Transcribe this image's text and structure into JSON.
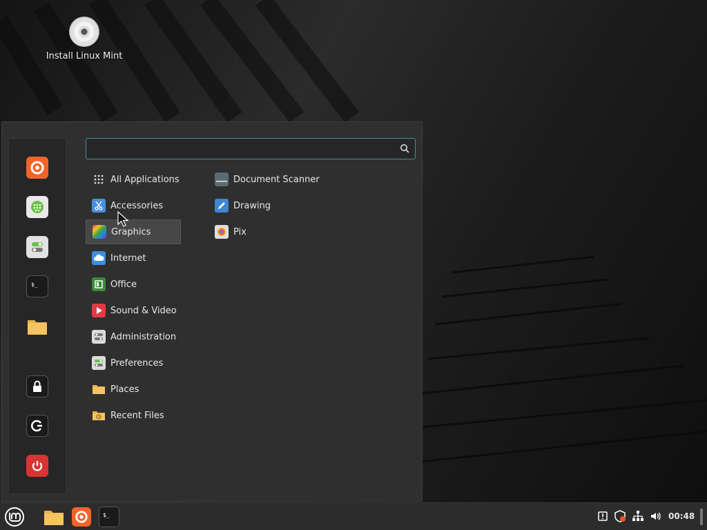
{
  "desktop": {
    "icon_label": "Install Linux Mint"
  },
  "menu": {
    "search": {
      "value": "",
      "placeholder": ""
    },
    "favorites": [
      {
        "name": "firefox-icon"
      },
      {
        "name": "software-manager-icon"
      },
      {
        "name": "settings-icon"
      },
      {
        "name": "terminal-icon"
      },
      {
        "name": "files-icon"
      },
      {
        "name": "lock-icon"
      },
      {
        "name": "logout-icon"
      },
      {
        "name": "power-icon"
      }
    ],
    "categories": [
      {
        "label": "All Applications"
      },
      {
        "label": "Accessories"
      },
      {
        "label": "Graphics"
      },
      {
        "label": "Internet"
      },
      {
        "label": "Office"
      },
      {
        "label": "Sound & Video"
      },
      {
        "label": "Administration"
      },
      {
        "label": "Preferences"
      },
      {
        "label": "Places"
      },
      {
        "label": "Recent Files"
      }
    ],
    "selected_category": "Graphics",
    "apps": [
      {
        "label": "Document Scanner"
      },
      {
        "label": "Drawing"
      },
      {
        "label": "Pix"
      }
    ]
  },
  "taskbar": {
    "clock": "00:48"
  },
  "colors": {
    "accent": "#4a8e99",
    "firefox": "#f2652a",
    "power": "#d93434",
    "folder": "#f5c45e"
  }
}
